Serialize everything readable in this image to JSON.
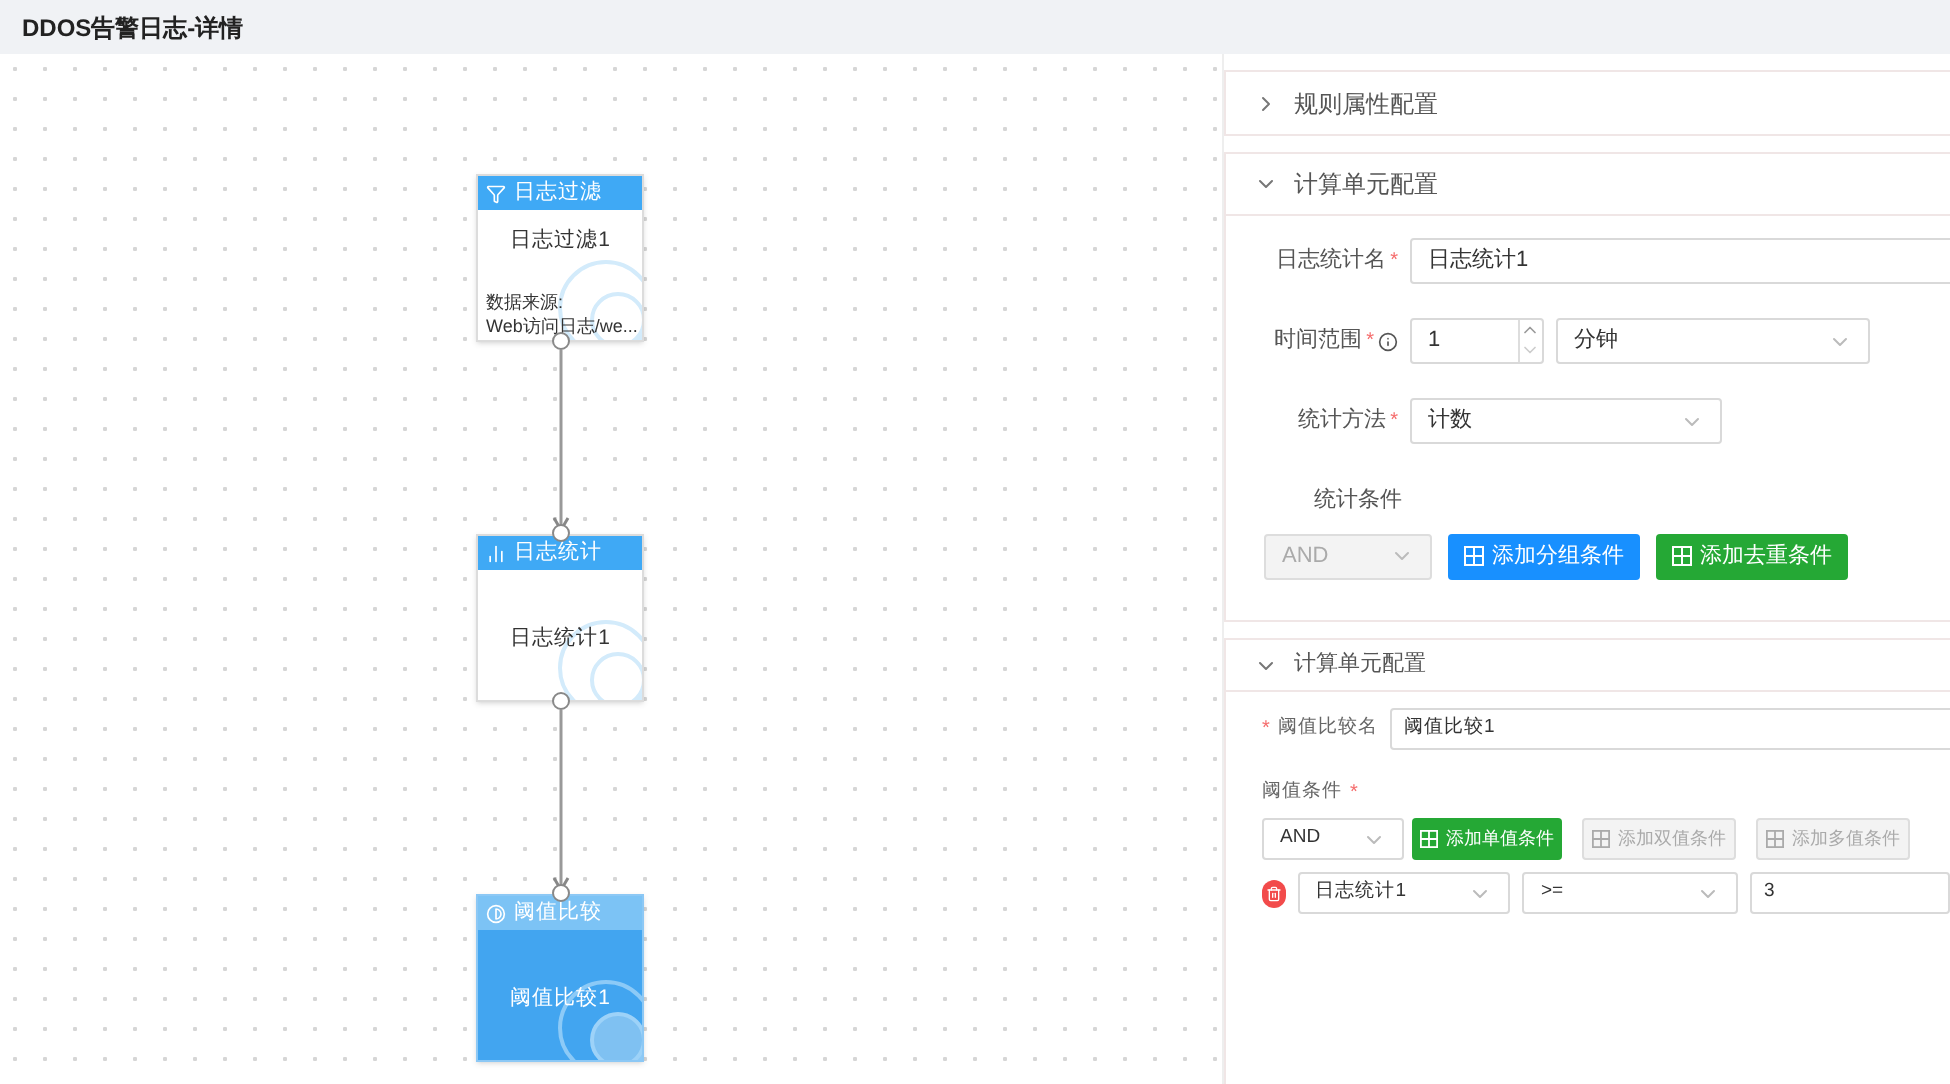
{
  "title": "DDOS告警日志-详情",
  "nodes": [
    {
      "kind": "filter",
      "header": "日志过滤",
      "name": "日志过滤1",
      "detail_label": "数据来源:",
      "detail_value": "Web访问日志/we...",
      "selected": false
    },
    {
      "kind": "stats",
      "header": "日志统计",
      "name": "日志统计1",
      "selected": false
    },
    {
      "kind": "threshold",
      "header": "阈值比较",
      "name": "阈值比较1",
      "selected": true
    }
  ],
  "rule_section": {
    "title": "规则属性配置",
    "expanded": false
  },
  "stats_section": {
    "title": "计算单元配置",
    "expanded": true,
    "name_field": {
      "label": "日志统计名",
      "required_mark": "*",
      "value": "日志统计1"
    },
    "time_field": {
      "label": "时间范围",
      "required_mark": "*",
      "value": "1",
      "unit": "分钟"
    },
    "method_field": {
      "label": "统计方法",
      "required_mark": "*",
      "value": "计数"
    },
    "conditions_label": "统计条件",
    "logic": {
      "value": "AND",
      "disabled": true
    },
    "buttons": [
      {
        "label": "添加分组条件",
        "kind": "primary",
        "disabled": false
      },
      {
        "label": "添加去重条件",
        "kind": "success",
        "disabled": false
      }
    ]
  },
  "threshold_section": {
    "title": "计算单元配置",
    "expanded": true,
    "name_field": {
      "label": "阈值比较名",
      "required_mark": "*",
      "value": "阈值比较1"
    },
    "conditions_label": "阈值条件",
    "conditions_required_mark": "*",
    "logic": {
      "value": "AND",
      "disabled": false
    },
    "buttons": [
      {
        "label": "添加单值条件",
        "kind": "success",
        "disabled": false
      },
      {
        "label": "添加双值条件",
        "disabled": true
      },
      {
        "label": "添加多值条件",
        "disabled": true
      }
    ],
    "condition": {
      "field": "日志统计1",
      "operator": ">=",
      "value": "3"
    }
  }
}
